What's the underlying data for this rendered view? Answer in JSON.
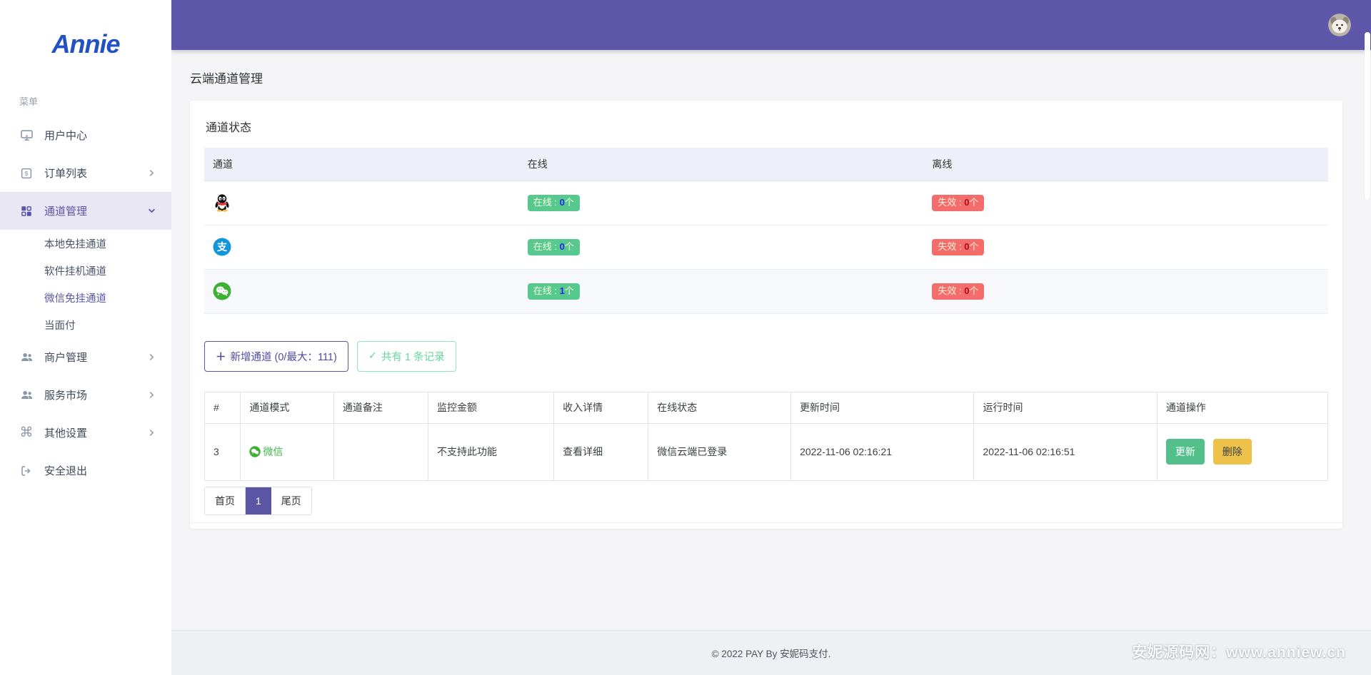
{
  "colors": {
    "accent": "#5e57a9",
    "success_badge": "#57c88e",
    "danger_badge": "#f56c6c",
    "update_button": "#53c08c",
    "delete_button": "#eec24a",
    "wechat_green": "#42b549",
    "alipay_blue": "#1296db",
    "logo_blue": "#2151c5"
  },
  "sidebar": {
    "logo": "Annie",
    "menu_label": "菜单",
    "items": [
      {
        "label": "用户中心",
        "icon": "monitor-icon"
      },
      {
        "label": "订单列表",
        "icon": "order-list-icon"
      },
      {
        "label": "通道管理",
        "icon": "channels-icon",
        "active": true
      },
      {
        "label": "本地免挂通道"
      },
      {
        "label": "软件挂机通道"
      },
      {
        "label": "微信免挂通道",
        "active": true
      },
      {
        "label": "当面付"
      },
      {
        "label": "商户管理",
        "icon": "merchants-icon"
      },
      {
        "label": "服务市场",
        "icon": "market-icon"
      },
      {
        "label": "其他设置",
        "icon": "settings-icon"
      },
      {
        "label": "安全退出",
        "icon": "logout-icon"
      }
    ]
  },
  "icons": {
    "command_glyph": "⌘",
    "order_symbol": "$",
    "alipay_symbol": "支",
    "plus_glyph": "＋",
    "check_glyph": "✓"
  },
  "page": {
    "title": "云端通道管理"
  },
  "status_card": {
    "title": "通道状态",
    "headers": [
      "通道",
      "在线",
      "离线"
    ],
    "online_label": "在线 : ",
    "offline_label": "失效 : ",
    "unit": "个",
    "rows": [
      {
        "channel": "QQ",
        "online": "0",
        "offline": "0"
      },
      {
        "channel": "支付宝",
        "online": "0",
        "offline": "0"
      },
      {
        "channel": "微信",
        "online": "1",
        "offline": "0"
      }
    ],
    "add_button": "新增通道 (0/最大：111)",
    "count_button": "共有 1 条记录"
  },
  "channel_table": {
    "headers": [
      "#",
      "通道模式",
      "通道备注",
      "监控金额",
      "收入详情",
      "在线状态",
      "更新时间",
      "运行时间",
      "通道操作"
    ],
    "rows": [
      {
        "id": "3",
        "mode": "微信",
        "remark": "",
        "monitor": "不支持此功能",
        "income": "查看详细",
        "status": "微信云端已登录",
        "update_time": "2022-11-06 02:16:21",
        "run_time": "2022-11-06 02:16:51",
        "update_action": "更新",
        "delete_action": "删除"
      }
    ]
  },
  "pagination": {
    "first": "首页",
    "current": "1",
    "last": "尾页"
  },
  "footer": {
    "copyright": "© 2022 PAY By 安妮码支付."
  },
  "watermark": "安妮源码网：www.anniew.cn"
}
